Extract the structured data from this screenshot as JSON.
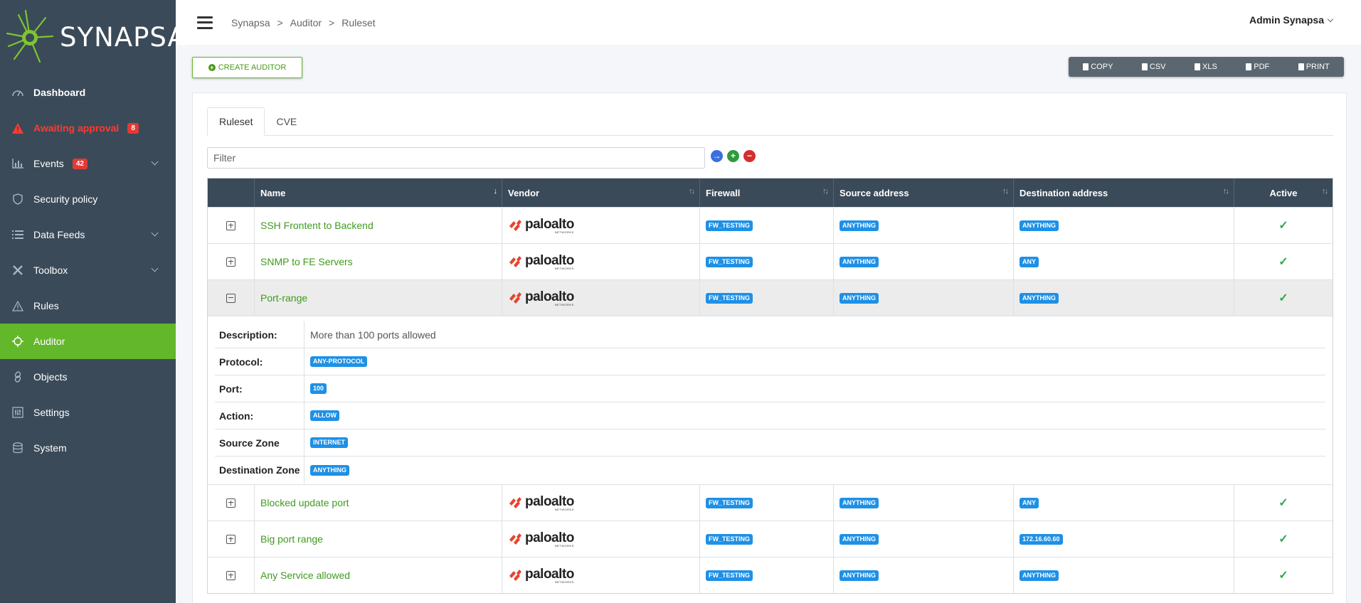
{
  "app": {
    "logo_text": "SYNAPSA"
  },
  "sidebar": {
    "items": [
      {
        "label": "Dashboard",
        "icon": "gauge-icon"
      },
      {
        "label": "Awaiting approval",
        "icon": "warning-icon",
        "badge": "8"
      },
      {
        "label": "Events",
        "icon": "bar-chart-icon",
        "badge": "42"
      },
      {
        "label": "Security policy",
        "icon": "shield-icon"
      },
      {
        "label": "Data Feeds",
        "icon": "list-icon"
      },
      {
        "label": "Toolbox",
        "icon": "tools-icon"
      },
      {
        "label": "Rules",
        "icon": "warning-outline-icon"
      },
      {
        "label": "Auditor",
        "icon": "crosshair-icon"
      },
      {
        "label": "Objects",
        "icon": "link-icon"
      },
      {
        "label": "Settings",
        "icon": "sliders-icon"
      },
      {
        "label": "System",
        "icon": "database-icon"
      }
    ]
  },
  "header": {
    "breadcrumb": [
      "Synapsa",
      "Auditor",
      "Ruleset"
    ],
    "separator": ">",
    "user": "Admin Synapsa"
  },
  "toolbar": {
    "create_label": "CREATE AUDITOR",
    "exports": [
      "COPY",
      "CSV",
      "XLS",
      "PDF",
      "PRINT"
    ]
  },
  "tabs": [
    "Ruleset",
    "CVE"
  ],
  "filter": {
    "placeholder": "Filter"
  },
  "table": {
    "columns": [
      "Name",
      "Vendor",
      "Firewall",
      "Source address",
      "Destination address",
      "Active"
    ],
    "vendor_logo": {
      "word": "paloalto",
      "sub": "NETWORKS"
    },
    "rows": [
      {
        "name": "SSH Frontent to Backend",
        "firewall": "FW_TESTING",
        "source": "ANYTHING",
        "destination": "ANYTHING",
        "active": "✓"
      },
      {
        "name": "SNMP to FE Servers",
        "firewall": "FW_TESTING",
        "source": "ANYTHING",
        "destination": "ANY",
        "active": "✓"
      },
      {
        "name": "Port-range",
        "firewall": "FW_TESTING",
        "source": "ANYTHING",
        "destination": "ANYTHING",
        "active": "✓"
      },
      {
        "name": "Blocked update port",
        "firewall": "FW_TESTING",
        "source": "ANYTHING",
        "destination": "ANY",
        "active": "✓"
      },
      {
        "name": "Big port range",
        "firewall": "FW_TESTING",
        "source": "ANYTHING",
        "destination": "172.16.60.60",
        "active": "✓"
      },
      {
        "name": "Any Service allowed",
        "firewall": "FW_TESTING",
        "source": "ANYTHING",
        "destination": "ANYTHING",
        "active": "✓"
      }
    ],
    "details": {
      "description_label": "Description:",
      "description": "More than 100 ports allowed",
      "protocol_label": "Protocol:",
      "protocol": "ANY-PROTOCOL",
      "port_label": "Port:",
      "port": "100",
      "action_label": "Action:",
      "action": "ALLOW",
      "source_zone_label": "Source Zone",
      "source_zone": "INTERNET",
      "destination_zone_label": "Destination Zone",
      "destination_zone": "ANYTHING"
    }
  },
  "colors": {
    "sidebar_bg": "#3a4a58",
    "accent_green": "#63b72a",
    "alert_red": "#ff3b30",
    "tag_blue": "#1e90e6"
  }
}
